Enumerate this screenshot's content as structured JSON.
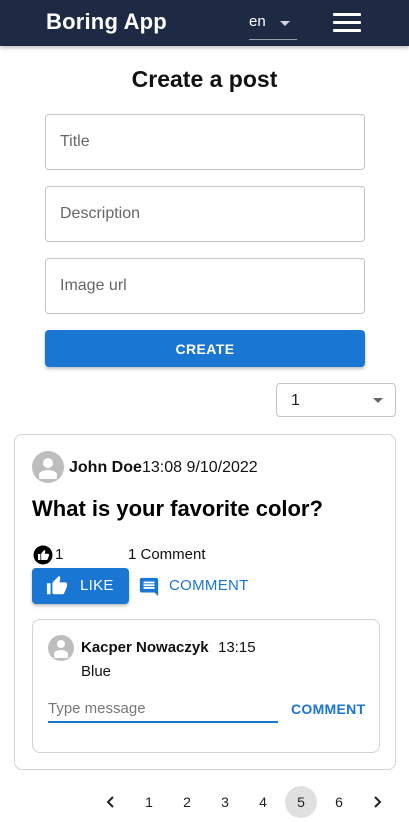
{
  "header": {
    "app_title": "Boring App",
    "language": "en",
    "menu_icon": "hamburger-menu-icon"
  },
  "create_post": {
    "heading": "Create a post",
    "title_placeholder": "Title",
    "description_placeholder": "Description",
    "image_url_placeholder": "Image url",
    "create_label": "CREATE"
  },
  "page_size_select": {
    "value": "1"
  },
  "post": {
    "author": "John Doe",
    "timestamp": "13:08 9/10/2022",
    "title": "What is your favorite color?",
    "like_count": "1",
    "comment_count": "1 Comment",
    "like_label": "LIKE",
    "comment_label": "COMMENT",
    "comments": [
      {
        "author": "Kacper Nowaczyk",
        "time": "13:15",
        "text": "Blue"
      }
    ],
    "message_placeholder": "Type message",
    "send_label": "COMMENT"
  },
  "pagination": {
    "pages": [
      "1",
      "2",
      "3",
      "4",
      "5",
      "6"
    ],
    "current": "5"
  },
  "colors": {
    "appbar": "#1e2a44",
    "primary": "#1976d2",
    "avatar": "#bdbdbd"
  }
}
